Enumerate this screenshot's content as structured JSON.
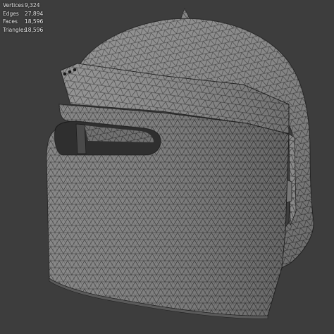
{
  "overlay": {
    "stats": [
      {
        "label": "Vertices",
        "value": "9,324"
      },
      {
        "label": "Edges",
        "value": "27,894"
      },
      {
        "label": "Faces",
        "value": "18,596"
      },
      {
        "label": "Triangles",
        "value": "18,596"
      }
    ]
  },
  "viewport": {
    "background_color": "#3d3d3d",
    "mesh_fill_color": "#7f7f7f",
    "wire_color": "#1e1e1e",
    "object": "helmet-mesh"
  }
}
